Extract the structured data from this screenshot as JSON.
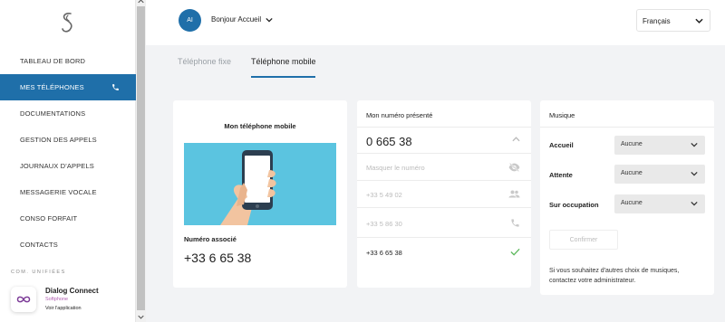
{
  "sidebar": {
    "items": [
      {
        "label": "TABLEAU DE BORD",
        "active": false
      },
      {
        "label": "MES TÉLÉPHONES",
        "active": true,
        "icon": "phone-icon"
      },
      {
        "label": "DOCUMENTATIONS",
        "active": false
      },
      {
        "label": "GESTION DES APPELS",
        "active": false
      },
      {
        "label": "JOURNAUX D'APPELS",
        "active": false
      },
      {
        "label": "MESSAGERIE VOCALE",
        "active": false
      },
      {
        "label": "CONSO FORFAIT",
        "active": false
      },
      {
        "label": "CONTACTS",
        "active": false
      }
    ],
    "section_label": "COM. UNIFIÉES",
    "app": {
      "title": "Dialog Connect",
      "subtitle": "Softphone",
      "link": "Voir l'application",
      "icon": "infinity-icon"
    }
  },
  "header": {
    "avatar_initials": "AI",
    "user_name": "Bonjour Accueil",
    "language": "Français"
  },
  "tabs": [
    {
      "label": "Téléphone fixe",
      "active": false
    },
    {
      "label": "Téléphone mobile",
      "active": true
    }
  ],
  "mobile_card": {
    "title": "Mon téléphone mobile",
    "associated_label": "Numéro associé",
    "associated_number": "+33 6 65 38"
  },
  "presented_card": {
    "title": "Mon numéro présenté",
    "selected_number": "0 665 38",
    "options": [
      {
        "label": "Masquer le numéro",
        "icon": "eye-slash-icon"
      },
      {
        "label": "+33 5 49 02",
        "icon": "group-icon"
      },
      {
        "label": "+33 5 86 30",
        "icon": "phone-icon"
      },
      {
        "label": "+33 6 65 38",
        "icon": "check-icon",
        "selected": true
      }
    ]
  },
  "music_card": {
    "title": "Musique",
    "rows": [
      {
        "label": "Accueil",
        "value": "Aucune"
      },
      {
        "label": "Attente",
        "value": "Aucune"
      },
      {
        "label": "Sur occupation",
        "value": "Aucune"
      }
    ],
    "confirm_label": "Confirmer",
    "note": "Si vous souhaitez d'autres choix de musiques, contactez votre administrateur."
  },
  "colors": {
    "accent": "#1f6fa9",
    "check": "#5cb85c",
    "illustration_bg": "#5bc4e0"
  }
}
